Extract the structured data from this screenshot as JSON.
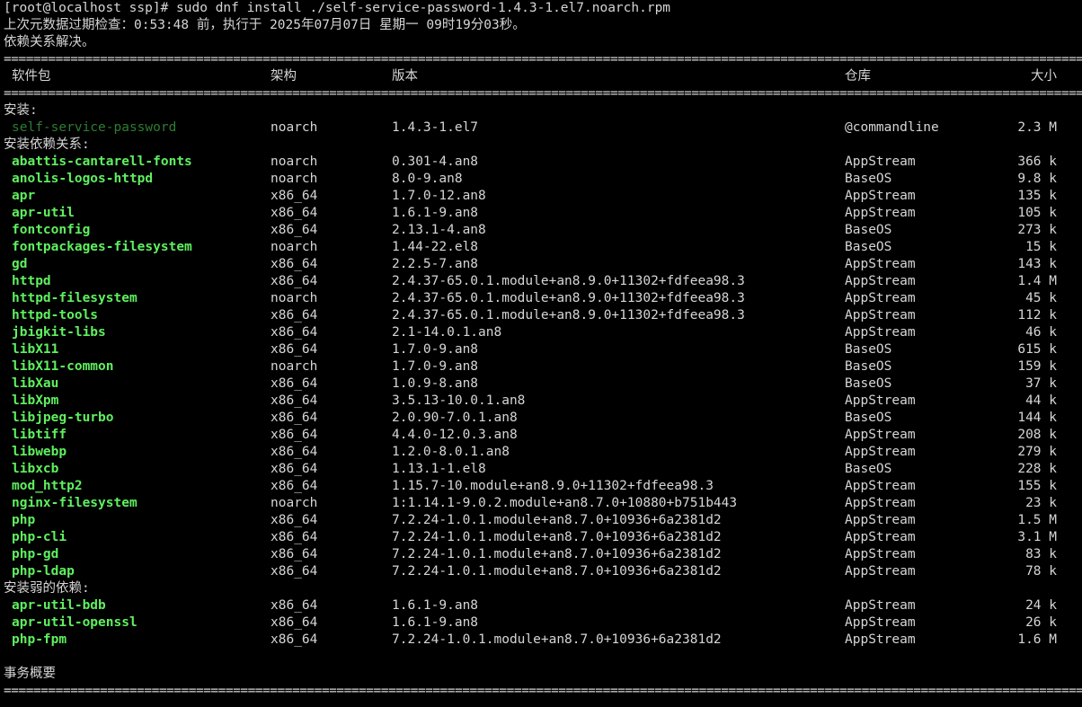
{
  "prompt_line": "[root@localhost ssp]# sudo dnf install ./self-service-password-1.4.3-1.el7.noarch.rpm",
  "metadata_line": "上次元数据过期检查：0:53:48 前，执行于 2025年07月07日 星期一 09时19分03秒。",
  "deps_resolved": "依赖关系解决。",
  "separator": "================================================================================================================================================================",
  "headers": {
    "package": "软件包",
    "arch": "架构",
    "version": "版本",
    "repo": "仓库",
    "size": "大小"
  },
  "sections": [
    {
      "title": "安装:",
      "rows": [
        {
          "name": "self-service-password",
          "arch": "noarch",
          "version": "1.4.3-1.el7",
          "repo": "@commandline",
          "size": "2.3 M",
          "style": "dim"
        }
      ]
    },
    {
      "title": "安装依赖关系:",
      "rows": [
        {
          "name": "abattis-cantarell-fonts",
          "arch": "noarch",
          "version": "0.301-4.an8",
          "repo": "AppStream",
          "size": "366 k",
          "style": "green"
        },
        {
          "name": "anolis-logos-httpd",
          "arch": "noarch",
          "version": "8.0-9.an8",
          "repo": "BaseOS",
          "size": "9.8 k",
          "style": "green"
        },
        {
          "name": "apr",
          "arch": "x86_64",
          "version": "1.7.0-12.an8",
          "repo": "AppStream",
          "size": "135 k",
          "style": "green"
        },
        {
          "name": "apr-util",
          "arch": "x86_64",
          "version": "1.6.1-9.an8",
          "repo": "AppStream",
          "size": "105 k",
          "style": "green"
        },
        {
          "name": "fontconfig",
          "arch": "x86_64",
          "version": "2.13.1-4.an8",
          "repo": "BaseOS",
          "size": "273 k",
          "style": "green"
        },
        {
          "name": "fontpackages-filesystem",
          "arch": "noarch",
          "version": "1.44-22.el8",
          "repo": "BaseOS",
          "size": "15 k",
          "style": "green"
        },
        {
          "name": "gd",
          "arch": "x86_64",
          "version": "2.2.5-7.an8",
          "repo": "AppStream",
          "size": "143 k",
          "style": "green"
        },
        {
          "name": "httpd",
          "arch": "x86_64",
          "version": "2.4.37-65.0.1.module+an8.9.0+11302+fdfeea98.3",
          "repo": "AppStream",
          "size": "1.4 M",
          "style": "green"
        },
        {
          "name": "httpd-filesystem",
          "arch": "noarch",
          "version": "2.4.37-65.0.1.module+an8.9.0+11302+fdfeea98.3",
          "repo": "AppStream",
          "size": "45 k",
          "style": "green"
        },
        {
          "name": "httpd-tools",
          "arch": "x86_64",
          "version": "2.4.37-65.0.1.module+an8.9.0+11302+fdfeea98.3",
          "repo": "AppStream",
          "size": "112 k",
          "style": "green"
        },
        {
          "name": "jbigkit-libs",
          "arch": "x86_64",
          "version": "2.1-14.0.1.an8",
          "repo": "AppStream",
          "size": "46 k",
          "style": "green"
        },
        {
          "name": "libX11",
          "arch": "x86_64",
          "version": "1.7.0-9.an8",
          "repo": "BaseOS",
          "size": "615 k",
          "style": "green"
        },
        {
          "name": "libX11-common",
          "arch": "noarch",
          "version": "1.7.0-9.an8",
          "repo": "BaseOS",
          "size": "159 k",
          "style": "green"
        },
        {
          "name": "libXau",
          "arch": "x86_64",
          "version": "1.0.9-8.an8",
          "repo": "BaseOS",
          "size": "37 k",
          "style": "green"
        },
        {
          "name": "libXpm",
          "arch": "x86_64",
          "version": "3.5.13-10.0.1.an8",
          "repo": "AppStream",
          "size": "44 k",
          "style": "green"
        },
        {
          "name": "libjpeg-turbo",
          "arch": "x86_64",
          "version": "2.0.90-7.0.1.an8",
          "repo": "BaseOS",
          "size": "144 k",
          "style": "green"
        },
        {
          "name": "libtiff",
          "arch": "x86_64",
          "version": "4.4.0-12.0.3.an8",
          "repo": "AppStream",
          "size": "208 k",
          "style": "green"
        },
        {
          "name": "libwebp",
          "arch": "x86_64",
          "version": "1.2.0-8.0.1.an8",
          "repo": "AppStream",
          "size": "279 k",
          "style": "green"
        },
        {
          "name": "libxcb",
          "arch": "x86_64",
          "version": "1.13.1-1.el8",
          "repo": "BaseOS",
          "size": "228 k",
          "style": "green"
        },
        {
          "name": "mod_http2",
          "arch": "x86_64",
          "version": "1.15.7-10.module+an8.9.0+11302+fdfeea98.3",
          "repo": "AppStream",
          "size": "155 k",
          "style": "green"
        },
        {
          "name": "nginx-filesystem",
          "arch": "noarch",
          "version": "1:1.14.1-9.0.2.module+an8.7.0+10880+b751b443",
          "repo": "AppStream",
          "size": "23 k",
          "style": "green"
        },
        {
          "name": "php",
          "arch": "x86_64",
          "version": "7.2.24-1.0.1.module+an8.7.0+10936+6a2381d2",
          "repo": "AppStream",
          "size": "1.5 M",
          "style": "green"
        },
        {
          "name": "php-cli",
          "arch": "x86_64",
          "version": "7.2.24-1.0.1.module+an8.7.0+10936+6a2381d2",
          "repo": "AppStream",
          "size": "3.1 M",
          "style": "green"
        },
        {
          "name": "php-gd",
          "arch": "x86_64",
          "version": "7.2.24-1.0.1.module+an8.7.0+10936+6a2381d2",
          "repo": "AppStream",
          "size": "83 k",
          "style": "green"
        },
        {
          "name": "php-ldap",
          "arch": "x86_64",
          "version": "7.2.24-1.0.1.module+an8.7.0+10936+6a2381d2",
          "repo": "AppStream",
          "size": "78 k",
          "style": "green"
        }
      ]
    },
    {
      "title": "安装弱的依赖:",
      "rows": [
        {
          "name": "apr-util-bdb",
          "arch": "x86_64",
          "version": "1.6.1-9.an8",
          "repo": "AppStream",
          "size": "24 k",
          "style": "green"
        },
        {
          "name": "apr-util-openssl",
          "arch": "x86_64",
          "version": "1.6.1-9.an8",
          "repo": "AppStream",
          "size": "26 k",
          "style": "green"
        },
        {
          "name": "php-fpm",
          "arch": "x86_64",
          "version": "7.2.24-1.0.1.module+an8.7.0+10936+6a2381d2",
          "repo": "AppStream",
          "size": "1.6 M",
          "style": "green"
        }
      ]
    }
  ],
  "summary_title": "事务概要",
  "colors": {
    "background": "#000000",
    "text": "#d6d6d6",
    "package_green": "#5ff05f",
    "package_dim": "#2e7d32"
  }
}
